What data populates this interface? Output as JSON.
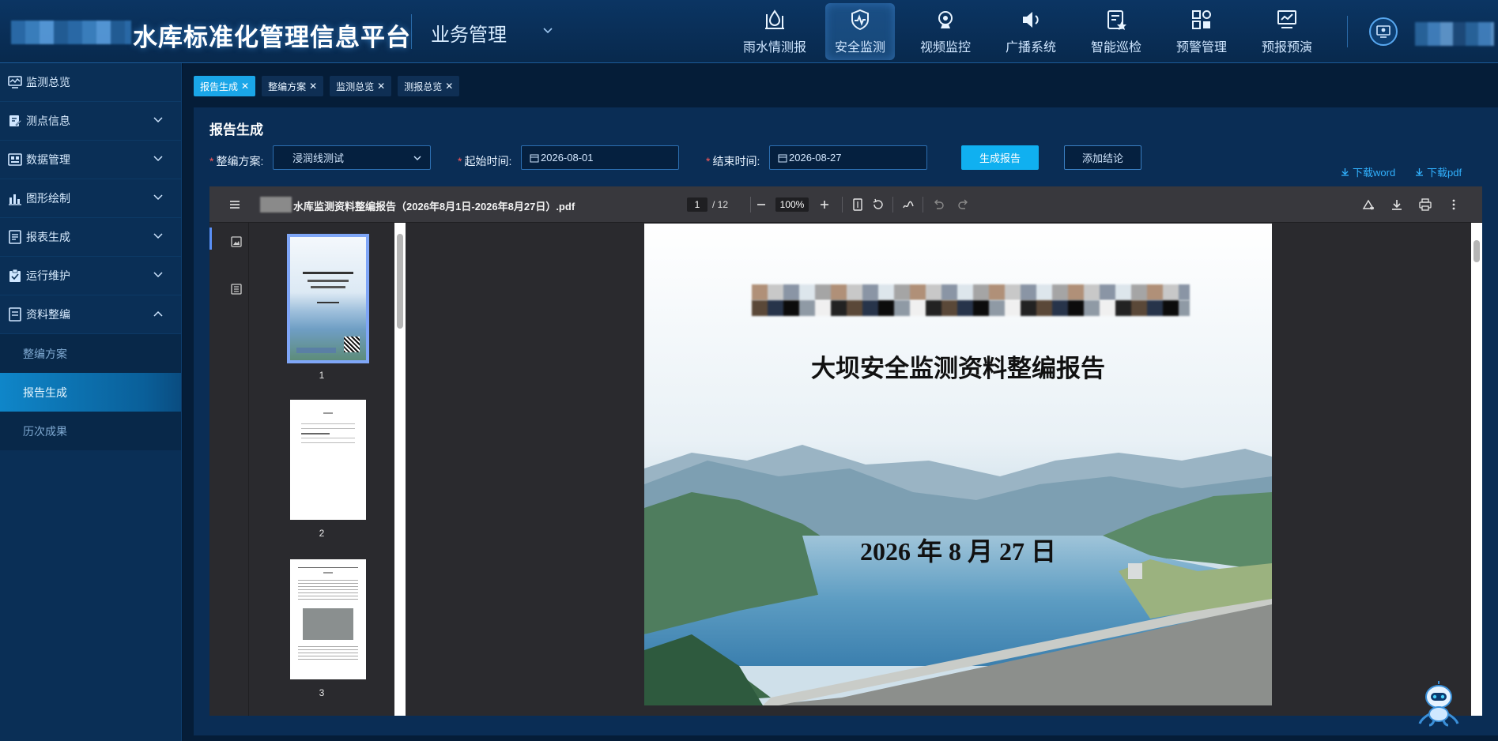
{
  "header": {
    "app_title": "水库标准化管理信息平台",
    "biz_menu": "业务管理",
    "nav": [
      {
        "label": "雨水情测报",
        "icon": "rain-gauge-icon"
      },
      {
        "label": "安全监测",
        "icon": "shield-pulse-icon",
        "active": true
      },
      {
        "label": "视频监控",
        "icon": "camera-icon"
      },
      {
        "label": "广播系统",
        "icon": "speaker-icon"
      },
      {
        "label": "智能巡检",
        "icon": "inspection-icon"
      },
      {
        "label": "预警管理",
        "icon": "grid-alert-icon"
      },
      {
        "label": "预报预演",
        "icon": "monitor-chart-icon"
      }
    ]
  },
  "sidebar": {
    "items": [
      {
        "label": "监测总览",
        "icon": "monitor-icon"
      },
      {
        "label": "测点信息",
        "icon": "edit-icon",
        "expandable": true
      },
      {
        "label": "数据管理",
        "icon": "database-icon",
        "expandable": true
      },
      {
        "label": "图形绘制",
        "icon": "bar-chart-icon",
        "expandable": true
      },
      {
        "label": "报表生成",
        "icon": "report-icon",
        "expandable": true
      },
      {
        "label": "运行维护",
        "icon": "clipboard-check-icon",
        "expandable": true
      },
      {
        "label": "资料整编",
        "icon": "document-icon",
        "expandable": true,
        "expanded": true
      }
    ],
    "sub_items": [
      {
        "label": "整编方案"
      },
      {
        "label": "报告生成",
        "active": true
      },
      {
        "label": "历次成果"
      }
    ]
  },
  "tabs": [
    {
      "label": "报告生成",
      "active": true
    },
    {
      "label": "整编方案"
    },
    {
      "label": "监测总览"
    },
    {
      "label": "测报总览"
    }
  ],
  "panel": {
    "title": "报告生成",
    "scheme_label": "整编方案:",
    "scheme_value": "浸润线测试",
    "start_label": "起始时间:",
    "start_value": "2026-08-01",
    "end_label": "结束时间:",
    "end_value": "2026-08-27",
    "generate_button": "生成报告",
    "conclusion_button": "添加结论",
    "download_word": "下载word",
    "download_pdf": "下载pdf"
  },
  "pdf": {
    "file_name": "水库监测资料整编报告（2026年8月1日-2026年8月27日）.pdf",
    "current_page": "1",
    "total_pages": "/ 12",
    "zoom": "100%",
    "thumbnails": [
      "1",
      "2",
      "3"
    ],
    "doc_title": "大坝安全监测资料整编报告",
    "doc_date": "2026 年 8 月 27 日"
  },
  "colors": {
    "accent": "#10b0f0",
    "header_bg": "#0b3563",
    "sidebar_bg": "#0a2f56",
    "active_sub": "#0f86c9",
    "required": "#ff5a5a",
    "link": "#31b2ff"
  }
}
